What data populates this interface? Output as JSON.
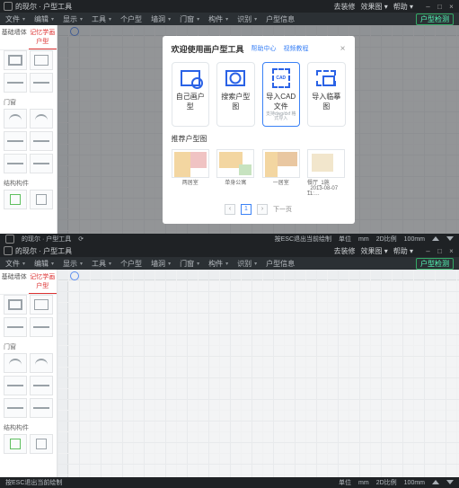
{
  "app_title": "的现尔 · 户型工具",
  "titlebar": {
    "right": [
      "去装修",
      "效果图 ▾",
      "帮助 ▾"
    ]
  },
  "menubar": {
    "left": [
      "文件",
      "编辑",
      "显示",
      "工具",
      "个户型",
      "墙洞",
      "门窗",
      "构件",
      "识别",
      "户型信息"
    ],
    "right": [
      "户型检测"
    ]
  },
  "leftpanel": {
    "tabs": [
      "基础墙体",
      "记忆学画户型"
    ],
    "active_tab": 1,
    "sections": {
      "walls": "",
      "doors": "门窗",
      "members": "结构构件"
    }
  },
  "statusbar": {
    "escape": "按ESC退出当前绘制",
    "unit": "单位",
    "unit_val": "mm",
    "scale": "2D比例",
    "scale_val": "100mm"
  },
  "modal": {
    "title": "欢迎使用画户型工具",
    "help1": "帮助中心",
    "help2": "视频教程",
    "options": [
      {
        "label": "自己画户型",
        "sub": ""
      },
      {
        "label": "搜索户型图",
        "sub": ""
      },
      {
        "label": "导入CAD文件",
        "sub": "支持dwg/dxf\n格式导入"
      },
      {
        "label": "导入临摹图",
        "sub": ""
      }
    ],
    "templates_title": "推荐户型图",
    "templates": [
      {
        "label": "两居室"
      },
      {
        "label": "单身公寓"
      },
      {
        "label": "一居室"
      },
      {
        "label": "餐厅_1施_2013-08-07 11:…"
      }
    ],
    "pager": {
      "page": "1",
      "next": "下一页"
    }
  }
}
